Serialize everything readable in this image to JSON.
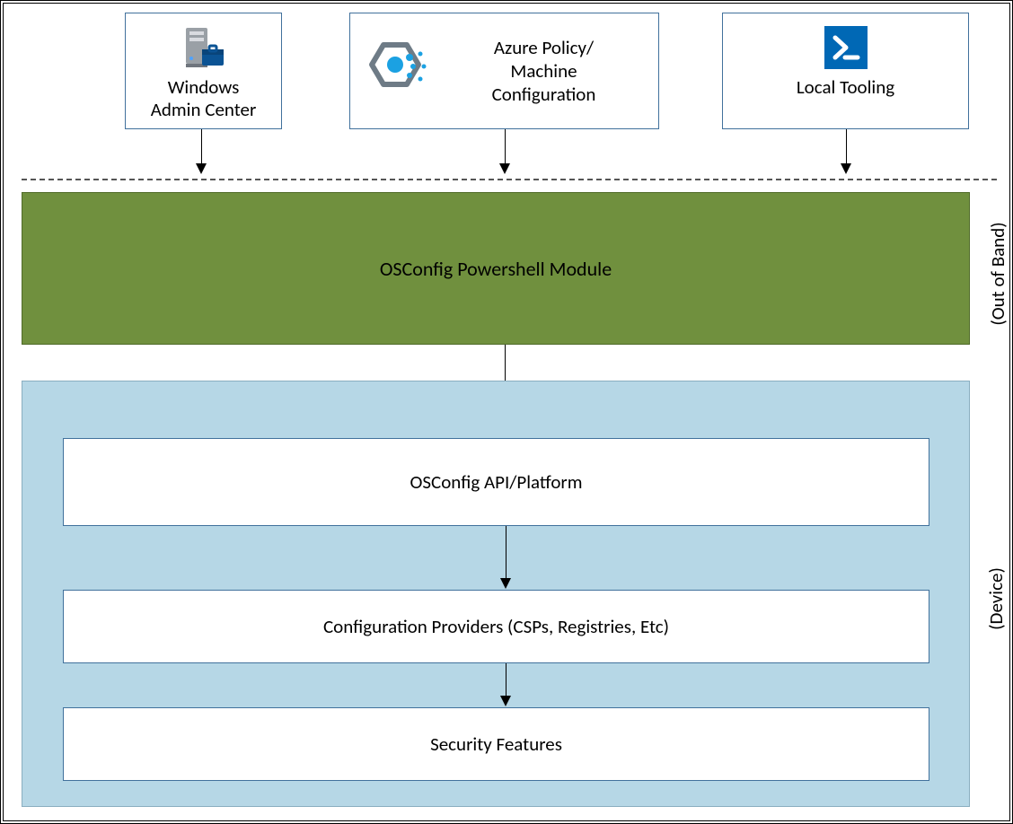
{
  "top": {
    "wac": {
      "line1": "Windows",
      "line2": "Admin Center"
    },
    "azure": {
      "line1": "Azure Policy/",
      "line2": "Machine",
      "line3": "Configuration"
    },
    "local": {
      "label": "Local Tooling"
    }
  },
  "band": {
    "label": "OSConfig Powershell Module",
    "side_label": "(Out of Band)"
  },
  "device": {
    "side_label": "(Device)",
    "api": "OSConfig API/Platform",
    "providers": "Configuration Providers (CSPs, Registries, Etc)",
    "security": "Security Features"
  }
}
